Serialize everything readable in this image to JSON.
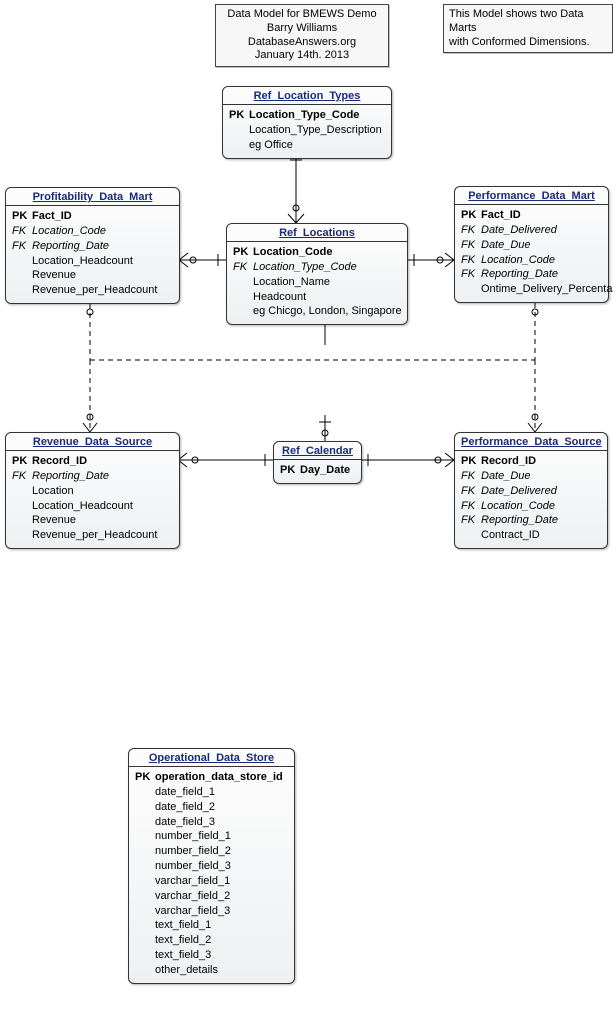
{
  "notes": {
    "topLeft": {
      "line1": "Data Model for BMEWS Demo",
      "line2": "Barry Williams",
      "line3": "DatabaseAnswers.org",
      "line4": "January 14th. 2013"
    },
    "topRight": {
      "line1": "This Model shows two Data Marts",
      "line2": "with Conformed Dimensions."
    }
  },
  "entities": {
    "refLocationTypes": {
      "title": "Ref_Location_Types",
      "rows": [
        {
          "key": "PK",
          "name": "Location_Type_Code",
          "pk": true
        },
        {
          "key": "",
          "name": "Location_Type_Description"
        },
        {
          "key": "",
          "name": "eg Office"
        }
      ]
    },
    "profitability": {
      "title": "Profitability_Data_Mart",
      "rows": [
        {
          "key": "PK",
          "name": "Fact_ID",
          "pk": true
        },
        {
          "key": "FK",
          "name": "Location_Code",
          "fk": true
        },
        {
          "key": "FK",
          "name": "Reporting_Date",
          "fk": true
        },
        {
          "key": "",
          "name": "Location_Headcount"
        },
        {
          "key": "",
          "name": "Revenue"
        },
        {
          "key": "",
          "name": "Revenue_per_Headcount"
        }
      ]
    },
    "performance": {
      "title": "Performance_Data_Mart",
      "rows": [
        {
          "key": "PK",
          "name": "Fact_ID",
          "pk": true
        },
        {
          "key": "FK",
          "name": "Date_Delivered",
          "fk": true
        },
        {
          "key": "FK",
          "name": "Date_Due",
          "fk": true
        },
        {
          "key": "FK",
          "name": "Location_Code",
          "fk": true
        },
        {
          "key": "FK",
          "name": "Reporting_Date",
          "fk": true
        },
        {
          "key": "",
          "name": "Ontime_Delivery_Percentage"
        }
      ]
    },
    "refLocations": {
      "title": "Ref_Locations",
      "rows": [
        {
          "key": "PK",
          "name": "Location_Code",
          "pk": true
        },
        {
          "key": "FK",
          "name": "Location_Type_Code",
          "fk": true
        },
        {
          "key": "",
          "name": "Location_Name"
        },
        {
          "key": "",
          "name": "Headcount"
        },
        {
          "key": "",
          "name": "eg Chicgo, London, Singapore"
        }
      ]
    },
    "revenueDS": {
      "title": "Revenue_Data_Source",
      "rows": [
        {
          "key": "PK",
          "name": "Record_ID",
          "pk": true
        },
        {
          "key": "FK",
          "name": "Reporting_Date",
          "fk": true
        },
        {
          "key": "",
          "name": "Location"
        },
        {
          "key": "",
          "name": "Location_Headcount"
        },
        {
          "key": "",
          "name": "Revenue"
        },
        {
          "key": "",
          "name": "Revenue_per_Headcount"
        }
      ]
    },
    "refCalendar": {
      "title": "Ref_Calendar",
      "rows": [
        {
          "key": "PK",
          "name": "Day_Date",
          "pk": true
        }
      ]
    },
    "performanceDS": {
      "title": "Performance_Data_Source",
      "rows": [
        {
          "key": "PK",
          "name": "Record_ID",
          "pk": true
        },
        {
          "key": "FK",
          "name": "Date_Due",
          "fk": true
        },
        {
          "key": "FK",
          "name": "Date_Delivered",
          "fk": true
        },
        {
          "key": "FK",
          "name": "Location_Code",
          "fk": true
        },
        {
          "key": "FK",
          "name": "Reporting_Date",
          "fk": true
        },
        {
          "key": "",
          "name": "Contract_ID"
        }
      ]
    },
    "ods": {
      "title": "Operational_Data_Store",
      "rows": [
        {
          "key": "PK",
          "name": "operation_data_store_id",
          "pk": true
        },
        {
          "key": "",
          "name": "date_field_1"
        },
        {
          "key": "",
          "name": "date_field_2"
        },
        {
          "key": "",
          "name": "date_field_3"
        },
        {
          "key": "",
          "name": "number_field_1"
        },
        {
          "key": "",
          "name": "number_field_2"
        },
        {
          "key": "",
          "name": "number_field_3"
        },
        {
          "key": "",
          "name": "varchar_field_1"
        },
        {
          "key": "",
          "name": "varchar_field_2"
        },
        {
          "key": "",
          "name": "varchar_field_3"
        },
        {
          "key": "",
          "name": "text_field_1"
        },
        {
          "key": "",
          "name": "text_field_2"
        },
        {
          "key": "",
          "name": "text_field_3"
        },
        {
          "key": "",
          "name": "other_details"
        }
      ]
    }
  }
}
